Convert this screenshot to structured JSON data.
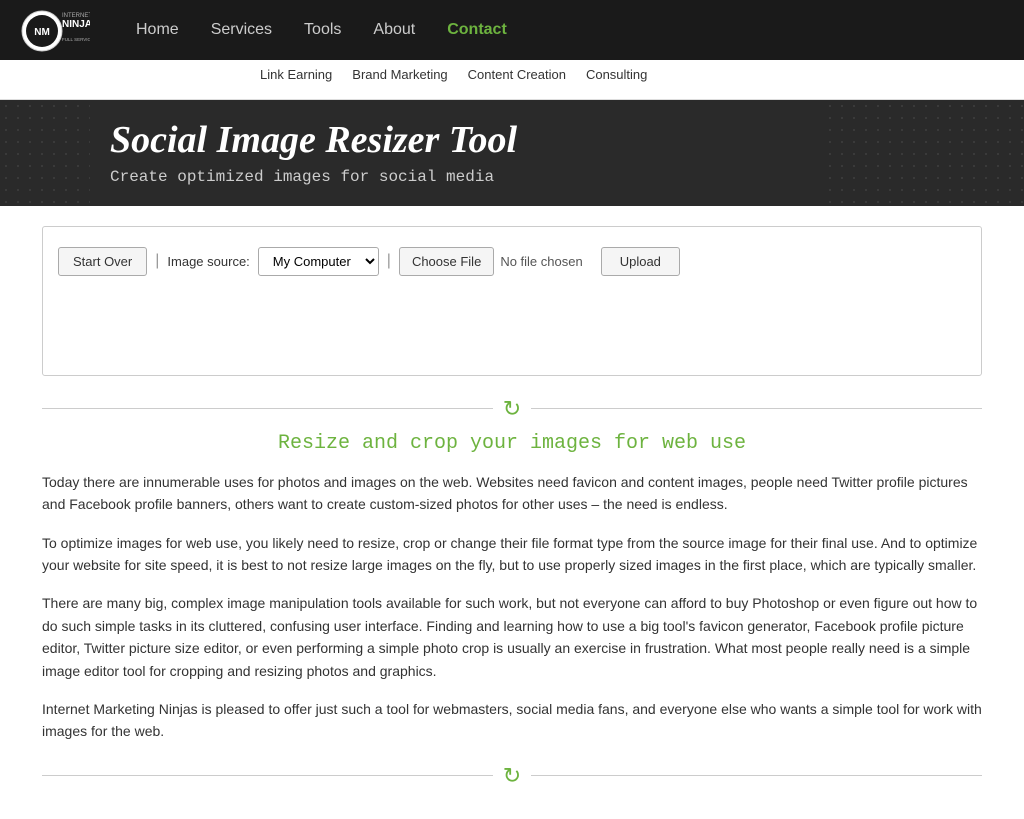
{
  "nav": {
    "items": [
      {
        "label": "Home",
        "active": false
      },
      {
        "label": "Services",
        "active": false
      },
      {
        "label": "Tools",
        "active": false
      },
      {
        "label": "About",
        "active": false
      },
      {
        "label": "Contact",
        "active": true
      }
    ],
    "sub_items": [
      {
        "label": "Link Earning"
      },
      {
        "label": "Brand Marketing"
      },
      {
        "label": "Content Creation"
      },
      {
        "label": "Consulting"
      }
    ]
  },
  "logo": {
    "line1": "INTERNET MARKETING",
    "line2": "NINJAS",
    "line3": "FULL SERVICE INTERNET MARKETING & TOOLS"
  },
  "hero": {
    "title": "Social Image Resizer Tool",
    "subtitle": "Create optimized images for social media"
  },
  "tool": {
    "start_over_label": "Start Over",
    "image_source_label": "Image source:",
    "source_option": "My Computer",
    "choose_file_label": "Choose File",
    "no_file_text": "No file chosen",
    "upload_label": "Upload"
  },
  "divider_icon": "↻",
  "section": {
    "heading": "Resize and crop your images for web use",
    "paragraphs": [
      "Today there are innumerable uses for photos and images on the web. Websites need favicon and content images, people need Twitter profile pictures and Facebook profile banners, others want to create custom-sized photos for other uses – the need is endless.",
      "To optimize images for web use, you likely need to resize, crop or change their file format type from the source image for their final use. And to optimize your website for site speed, it is best to not resize large images on the fly, but to use properly sized images in the first place, which are typically smaller.",
      "There are many big, complex image manipulation tools available for such work, but not everyone can afford to buy Photoshop or even figure out how to do such simple tasks in its cluttered, confusing user interface. Finding and learning how to use a big tool's favicon generator, Facebook profile picture editor, Twitter picture size editor, or even performing a simple photo crop is usually an exercise in frustration. What most people really need is a simple image editor tool for cropping and resizing photos and graphics.",
      "Internet Marketing Ninjas is pleased to offer just such a tool for webmasters, social media fans, and everyone else who wants a simple tool for work with images for the web."
    ]
  }
}
